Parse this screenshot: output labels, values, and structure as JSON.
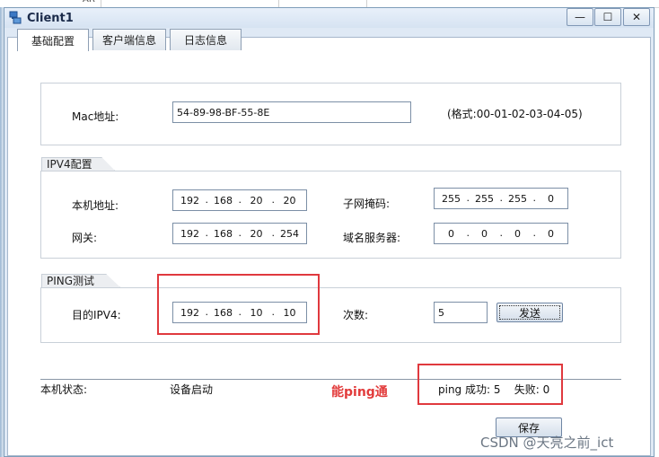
{
  "background_app": {
    "fragment_text": "AR"
  },
  "window": {
    "title": "Client1",
    "controls": {
      "minimize": "—",
      "maximize": "☐",
      "close": "✕"
    }
  },
  "tabs": [
    {
      "label": "基础配置",
      "active": true
    },
    {
      "label": "客户端信息",
      "active": false
    },
    {
      "label": "日志信息",
      "active": false
    }
  ],
  "mac": {
    "label": "Mac地址:",
    "value": "54-89-98-BF-55-8E",
    "format_hint": "(格式:00-01-02-03-04-05)"
  },
  "ipv4": {
    "group_title": "IPV4配置",
    "local_ip_label": "本机地址:",
    "local_ip": [
      "192",
      "168",
      "20",
      "20"
    ],
    "subnet_label": "子网掩码:",
    "subnet": [
      "255",
      "255",
      "255",
      "0"
    ],
    "gateway_label": "网关:",
    "gateway": [
      "192",
      "168",
      "20",
      "254"
    ],
    "dns_label": "域名服务器:",
    "dns": [
      "0",
      "0",
      "0",
      "0"
    ]
  },
  "ping": {
    "group_title": "PING测试",
    "target_label": "目的IPV4:",
    "target": [
      "192",
      "168",
      "10",
      "10"
    ],
    "count_label": "次数:",
    "count": "5",
    "send_label": "发送"
  },
  "status": {
    "label": "本机状态:",
    "value": "设备启动",
    "annotation": "能ping通",
    "result": "ping 成功: 5    失败: 0"
  },
  "save_label": "保存",
  "watermark": "CSDN @天亮之前_ict",
  "colors": {
    "highlight_box": "#e0393e",
    "annotation_text": "#e23b3b"
  }
}
